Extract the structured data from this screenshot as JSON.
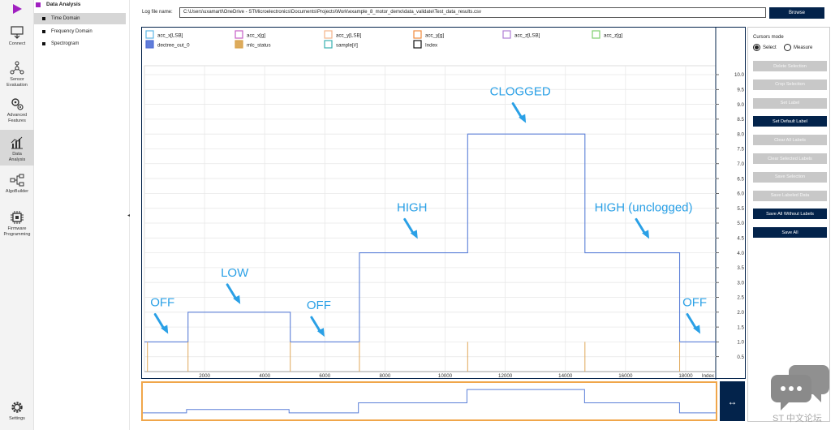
{
  "rail": {
    "items": [
      {
        "label": "Connect"
      },
      {
        "label": "Sensor Evaluation"
      },
      {
        "label": "Advanced Features"
      },
      {
        "label": "Data Analysis"
      },
      {
        "label": "AlgoBuilder"
      },
      {
        "label": "Firmware Programming"
      },
      {
        "label": "Settings"
      }
    ]
  },
  "subnav": {
    "title": "Data Analysis",
    "items": [
      {
        "label": "Time Domain"
      },
      {
        "label": "Frequency Domain"
      },
      {
        "label": "Spectrogram"
      }
    ],
    "collapse_glyph": "◂"
  },
  "log": {
    "label": "Log file name:",
    "value": "C:\\Users\\uxamartl\\OneDrive - STMicroelectronics\\Documents\\Projects\\Work\\example_8_motor_demo\\data_validate\\Test_data_results.csv",
    "browse": "Browse"
  },
  "legend": [
    {
      "label": "acc_x[LSB]",
      "color": "#5fb7e6",
      "checked": false
    },
    {
      "label": "acc_x[g]",
      "color": "#c45ec4",
      "checked": false
    },
    {
      "label": "acc_y[LSB]",
      "color": "#f4b38a",
      "checked": false
    },
    {
      "label": "acc_y[g]",
      "color": "#f08a3c",
      "checked": false
    },
    {
      "label": "acc_z[LSB]",
      "color": "#b07fd6",
      "checked": false
    },
    {
      "label": "acc_z[g]",
      "color": "#7fcf6e",
      "checked": false
    },
    {
      "label": "dectree_out_0",
      "color": "#4f6fd6",
      "checked": true
    },
    {
      "label": "mlc_status",
      "color": "#d9a24a",
      "checked": true
    },
    {
      "label": "sample[#]",
      "color": "#3ab0b0",
      "checked": false
    },
    {
      "label": "Index",
      "color": "#111111",
      "checked": false
    }
  ],
  "chart_data": {
    "type": "line",
    "title": "",
    "xlabel": "Index",
    "ylabel": "",
    "xlim": [
      0,
      19000
    ],
    "ylim": [
      0,
      10.3
    ],
    "x_ticks": [
      2000,
      4000,
      6000,
      8000,
      10000,
      12000,
      14000,
      16000,
      18000
    ],
    "x_tick_labels": [
      "2000",
      "4000",
      "6000",
      "8000",
      "10000",
      "12000",
      "14000",
      "16000",
      "18000"
    ],
    "y_ticks": [
      0.5,
      1.0,
      1.5,
      2.0,
      2.5,
      3.0,
      3.5,
      4.0,
      4.5,
      5.0,
      5.5,
      6.0,
      6.5,
      7.0,
      7.5,
      8.0,
      8.5,
      9.0,
      9.5,
      10.0
    ],
    "y_tick_labels": [
      "0.5",
      "1.0",
      "1.5",
      "2.0",
      "2.5",
      "3.0",
      "3.5",
      "4.0",
      "4.5",
      "5.0",
      "5.5",
      "6.0",
      "6.5",
      "7.0",
      "7.5",
      "8.0",
      "8.5",
      "9.0",
      "9.5",
      "10.0"
    ],
    "grid": true,
    "series": [
      {
        "name": "dectree_out_0",
        "color": "#5b7fd8",
        "step": true,
        "x": [
          0,
          1450,
          1450,
          4850,
          4850,
          7150,
          7150,
          10750,
          10750,
          14650,
          14650,
          17800,
          17800,
          19000
        ],
        "y": [
          1,
          1,
          2,
          2,
          1,
          1,
          4,
          4,
          8,
          8,
          4,
          4,
          1,
          1
        ]
      },
      {
        "name": "mlc_status",
        "color": "#e0a85a",
        "impulse": true,
        "x": [
          100,
          1450,
          4850,
          7150,
          10750,
          14650,
          17800
        ],
        "y": [
          1,
          1,
          1,
          1,
          1,
          1,
          1
        ]
      }
    ],
    "annotations": [
      {
        "text": "OFF",
        "x": 600,
        "y": 2.2
      },
      {
        "text": "LOW",
        "x": 3000,
        "y": 3.2
      },
      {
        "text": "OFF",
        "x": 5800,
        "y": 2.1
      },
      {
        "text": "HIGH",
        "x": 8900,
        "y": 5.4
      },
      {
        "text": "CLOGGED",
        "x": 12500,
        "y": 9.3
      },
      {
        "text": "HIGH (unclogged)",
        "x": 16600,
        "y": 5.4
      },
      {
        "text": "OFF",
        "x": 18300,
        "y": 2.2
      }
    ]
  },
  "annotation_color": "#2aa0e6",
  "cursors": {
    "title": "Cursors mode",
    "options": [
      "Select",
      "Measure"
    ],
    "selected": "Select"
  },
  "buttons": [
    {
      "label": "Delete Selection",
      "enabled": false
    },
    {
      "label": "Crop Selection",
      "enabled": false
    },
    {
      "label": "Set Label",
      "enabled": false
    },
    {
      "label": "Set Default Label",
      "enabled": true
    },
    {
      "label": "Clear All Labels",
      "enabled": false
    },
    {
      "label": "Clear Selected Labels",
      "enabled": false
    },
    {
      "label": "Save Selection",
      "enabled": false
    },
    {
      "label": "Save Labeled Data",
      "enabled": false
    },
    {
      "label": "Save All Without Labels",
      "enabled": true
    },
    {
      "label": "Save All",
      "enabled": true
    }
  ],
  "zoom_glyph": "↔",
  "watermark": "ST 中文论坛"
}
